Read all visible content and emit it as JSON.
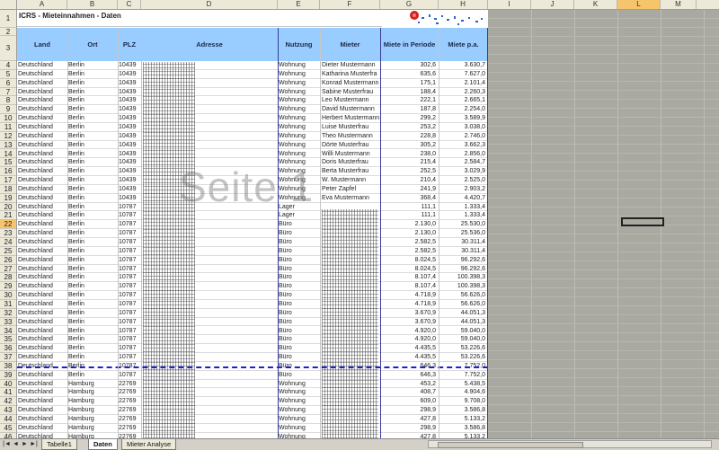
{
  "columns": [
    "A",
    "B",
    "C",
    "D",
    "E",
    "F",
    "G",
    "H",
    "I",
    "J",
    "K",
    "L",
    "M"
  ],
  "selected_column": "L",
  "selected_row": 22,
  "title": "ICRS - Mieteinnahmen - Daten",
  "headers": {
    "land": "Land",
    "ort": "Ort",
    "plz": "PLZ",
    "adresse": "Adresse",
    "nutzung": "Nutzung",
    "mieter": "Mieter",
    "miete_periode": "Miete in Periode",
    "miete_pa": "Miete p.a."
  },
  "rows": [
    {
      "n": "4",
      "land": "Deutschland",
      "ort": "Berlin",
      "plz": "10439",
      "nutzung": "Wohnung",
      "mieter": "Dieter Mustermann",
      "mp": "302,6",
      "pa": "3.630,7"
    },
    {
      "n": "5",
      "land": "Deutschland",
      "ort": "Berlin",
      "plz": "10439",
      "nutzung": "Wohnung",
      "mieter": "Katharina Musterfra",
      "mp": "635,6",
      "pa": "7.627,0"
    },
    {
      "n": "6",
      "land": "Deutschland",
      "ort": "Berlin",
      "plz": "10439",
      "nutzung": "Wohnung",
      "mieter": "Konrad Mustermann",
      "mp": "175,1",
      "pa": "2.101,4"
    },
    {
      "n": "7",
      "land": "Deutschland",
      "ort": "Berlin",
      "plz": "10439",
      "nutzung": "Wohnung",
      "mieter": "Sabine Musterfrau",
      "mp": "188,4",
      "pa": "2.260,3"
    },
    {
      "n": "8",
      "land": "Deutschland",
      "ort": "Berlin",
      "plz": "10439",
      "nutzung": "Wohnung",
      "mieter": "Leo Mustermann",
      "mp": "222,1",
      "pa": "2.665,1"
    },
    {
      "n": "9",
      "land": "Deutschland",
      "ort": "Berlin",
      "plz": "10439",
      "nutzung": "Wohnung",
      "mieter": "David Mustermann",
      "mp": "187,8",
      "pa": "2.254,0"
    },
    {
      "n": "10",
      "land": "Deutschland",
      "ort": "Berlin",
      "plz": "10439",
      "nutzung": "Wohnung",
      "mieter": "Herbert Mustermann",
      "mp": "299,2",
      "pa": "3.589,9"
    },
    {
      "n": "11",
      "land": "Deutschland",
      "ort": "Berlin",
      "plz": "10439",
      "nutzung": "Wohnung",
      "mieter": "Luise Musterfrau",
      "mp": "253,2",
      "pa": "3.038,0"
    },
    {
      "n": "12",
      "land": "Deutschland",
      "ort": "Berlin",
      "plz": "10439",
      "nutzung": "Wohnung",
      "mieter": "Theo Mustermann",
      "mp": "228,8",
      "pa": "2.746,0"
    },
    {
      "n": "13",
      "land": "Deutschland",
      "ort": "Berlin",
      "plz": "10439",
      "nutzung": "Wohnung",
      "mieter": "Dörte Musterfrau",
      "mp": "305,2",
      "pa": "3.662,3"
    },
    {
      "n": "14",
      "land": "Deutschland",
      "ort": "Berlin",
      "plz": "10439",
      "nutzung": "Wohnung",
      "mieter": "Willi Mustermann",
      "mp": "238,0",
      "pa": "2.856,0"
    },
    {
      "n": "15",
      "land": "Deutschland",
      "ort": "Berlin",
      "plz": "10439",
      "nutzung": "Wohnung",
      "mieter": "Doris Musterfrau",
      "mp": "215,4",
      "pa": "2.584,7"
    },
    {
      "n": "16",
      "land": "Deutschland",
      "ort": "Berlin",
      "plz": "10439",
      "nutzung": "Wohnung",
      "mieter": "Berta Musterfrau",
      "mp": "252,5",
      "pa": "3.029,9"
    },
    {
      "n": "17",
      "land": "Deutschland",
      "ort": "Berlin",
      "plz": "10439",
      "nutzung": "Wohnung",
      "mieter": "W. Mustermann",
      "mp": "210,4",
      "pa": "2.525,0"
    },
    {
      "n": "18",
      "land": "Deutschland",
      "ort": "Berlin",
      "plz": "10439",
      "nutzung": "Wohnung",
      "mieter": "Peter Zapfel",
      "mp": "241,9",
      "pa": "2.903,2"
    },
    {
      "n": "19",
      "land": "Deutschland",
      "ort": "Berlin",
      "plz": "10439",
      "nutzung": "Wohnung",
      "mieter": "Eva Mustermann",
      "mp": "368,4",
      "pa": "4.420,7"
    },
    {
      "n": "20",
      "land": "Deutschland",
      "ort": "Berlin",
      "plz": "10787",
      "nutzung": "Lager",
      "mieter": "",
      "mp": "111,1",
      "pa": "1.333,4"
    },
    {
      "n": "21",
      "land": "Deutschland",
      "ort": "Berlin",
      "plz": "10787",
      "nutzung": "Lager",
      "mieter": "",
      "mp": "111,1",
      "pa": "1.333,4"
    },
    {
      "n": "22",
      "land": "Deutschland",
      "ort": "Berlin",
      "plz": "10787",
      "nutzung": "Büro",
      "mieter": "",
      "mp": "2.130,0",
      "pa": "25.530,0"
    },
    {
      "n": "23",
      "land": "Deutschland",
      "ort": "Berlin",
      "plz": "10787",
      "nutzung": "Büro",
      "mieter": "",
      "mp": "2.130,0",
      "pa": "25.536,0"
    },
    {
      "n": "24",
      "land": "Deutschland",
      "ort": "Berlin",
      "plz": "10787",
      "nutzung": "Büro",
      "mieter": "",
      "mp": "2.582,5",
      "pa": "30.311,4"
    },
    {
      "n": "25",
      "land": "Deutschland",
      "ort": "Berlin",
      "plz": "10787",
      "nutzung": "Büro",
      "mieter": "",
      "mp": "2.582,5",
      "pa": "30.311,4"
    },
    {
      "n": "26",
      "land": "Deutschland",
      "ort": "Berlin",
      "plz": "10787",
      "nutzung": "Büro",
      "mieter": "",
      "mp": "8.024,5",
      "pa": "96.292,6"
    },
    {
      "n": "27",
      "land": "Deutschland",
      "ort": "Berlin",
      "plz": "10787",
      "nutzung": "Büro",
      "mieter": "",
      "mp": "8.024,5",
      "pa": "96.292,6"
    },
    {
      "n": "28",
      "land": "Deutschland",
      "ort": "Berlin",
      "plz": "10787",
      "nutzung": "Büro",
      "mieter": "",
      "mp": "8.107,4",
      "pa": "100.398,3"
    },
    {
      "n": "29",
      "land": "Deutschland",
      "ort": "Berlin",
      "plz": "10787",
      "nutzung": "Büro",
      "mieter": "",
      "mp": "8.107,4",
      "pa": "100.398,3"
    },
    {
      "n": "30",
      "land": "Deutschland",
      "ort": "Berlin",
      "plz": "10787",
      "nutzung": "Büro",
      "mieter": "",
      "mp": "4.718,9",
      "pa": "56.626,0"
    },
    {
      "n": "31",
      "land": "Deutschland",
      "ort": "Berlin",
      "plz": "10787",
      "nutzung": "Büro",
      "mieter": "",
      "mp": "4.718,9",
      "pa": "56.626,0"
    },
    {
      "n": "32",
      "land": "Deutschland",
      "ort": "Berlin",
      "plz": "10787",
      "nutzung": "Büro",
      "mieter": "",
      "mp": "3.670,9",
      "pa": "44.051,3"
    },
    {
      "n": "33",
      "land": "Deutschland",
      "ort": "Berlin",
      "plz": "10787",
      "nutzung": "Büro",
      "mieter": "",
      "mp": "3.670,9",
      "pa": "44.051,3"
    },
    {
      "n": "34",
      "land": "Deutschland",
      "ort": "Berlin",
      "plz": "10787",
      "nutzung": "Büro",
      "mieter": "",
      "mp": "4.920,0",
      "pa": "59.040,0"
    },
    {
      "n": "35",
      "land": "Deutschland",
      "ort": "Berlin",
      "plz": "10787",
      "nutzung": "Büro",
      "mieter": "",
      "mp": "4.920,0",
      "pa": "59.040,0"
    },
    {
      "n": "36",
      "land": "Deutschland",
      "ort": "Berlin",
      "plz": "10787",
      "nutzung": "Büro",
      "mieter": "",
      "mp": "4.435,5",
      "pa": "53.226,6"
    },
    {
      "n": "37",
      "land": "Deutschland",
      "ort": "Berlin",
      "plz": "10787",
      "nutzung": "Büro",
      "mieter": "",
      "mp": "4.435,5",
      "pa": "53.226,6"
    },
    {
      "n": "38",
      "land": "Deutschland",
      "ort": "Berlin",
      "plz": "10787",
      "nutzung": "Büro",
      "mieter": "",
      "mp": "646,3",
      "pa": "7.752,0"
    },
    {
      "n": "39",
      "land": "Deutschland",
      "ort": "Berlin",
      "plz": "10787",
      "nutzung": "Büro",
      "mieter": "",
      "mp": "646,3",
      "pa": "7.752,0"
    },
    {
      "n": "40",
      "land": "Deutschland",
      "ort": "Hamburg",
      "plz": "22769",
      "nutzung": "Wohnung",
      "mieter": "",
      "mp": "453,2",
      "pa": "5.438,5"
    },
    {
      "n": "41",
      "land": "Deutschland",
      "ort": "Hamburg",
      "plz": "22769",
      "nutzung": "Wohnung",
      "mieter": "",
      "mp": "408,7",
      "pa": "4.904,6"
    },
    {
      "n": "42",
      "land": "Deutschland",
      "ort": "Hamburg",
      "plz": "22769",
      "nutzung": "Wohnung",
      "mieter": "",
      "mp": "609,0",
      "pa": "9.708,0"
    },
    {
      "n": "43",
      "land": "Deutschland",
      "ort": "Hamburg",
      "plz": "22769",
      "nutzung": "Wohnung",
      "mieter": "",
      "mp": "298,9",
      "pa": "3.586,8"
    },
    {
      "n": "44",
      "land": "Deutschland",
      "ort": "Hamburg",
      "plz": "22769",
      "nutzung": "Wohnung",
      "mieter": "",
      "mp": "427,8",
      "pa": "5.133,2"
    },
    {
      "n": "45",
      "land": "Deutschland",
      "ort": "Hamburg",
      "plz": "22769",
      "nutzung": "Wohnung",
      "mieter": "",
      "mp": "298,9",
      "pa": "3.586,8"
    },
    {
      "n": "46",
      "land": "Deutschland",
      "ort": "Hamburg",
      "plz": "22769",
      "nutzung": "Wohnung",
      "mieter": "",
      "mp": "427,8",
      "pa": "5.133,2"
    }
  ],
  "watermark": "Seite 1",
  "sheet_tabs": [
    "Tabelle1",
    "Daten",
    "Mieter Analyse"
  ],
  "active_tab": "Daten",
  "nav_buttons": [
    "|◄",
    "◄",
    "►",
    "►|"
  ],
  "colors": {
    "header_bg": "#99ccff",
    "page_break": "#1f1fd0",
    "gray_area": "#a9a9a1"
  }
}
